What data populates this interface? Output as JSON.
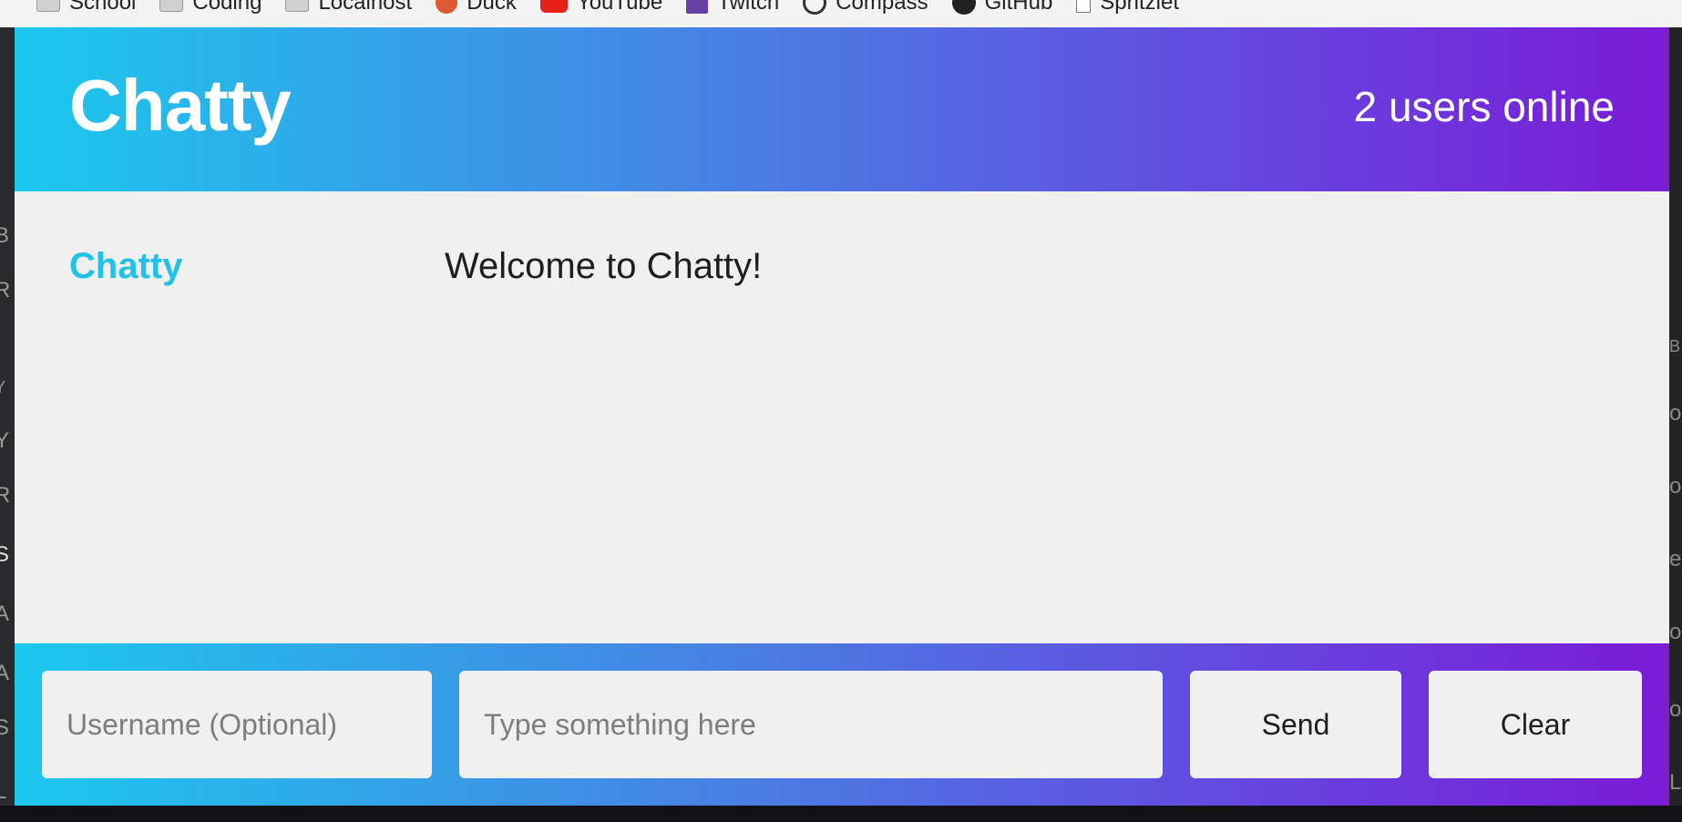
{
  "bookmarks": [
    {
      "label": "School",
      "icon": "folder-icon"
    },
    {
      "label": "Coding",
      "icon": "folder-icon"
    },
    {
      "label": "Localhost",
      "icon": "folder-icon"
    },
    {
      "label": "Duck",
      "icon": "duckduckgo-icon"
    },
    {
      "label": "YouTube",
      "icon": "youtube-icon"
    },
    {
      "label": "Twitch",
      "icon": "twitch-icon"
    },
    {
      "label": "Compass",
      "icon": "compass-icon"
    },
    {
      "label": "GitHub",
      "icon": "github-icon"
    },
    {
      "label": "Spritzlet",
      "icon": "page-icon"
    }
  ],
  "navbar": {
    "brand": "Chatty",
    "user_count": "2 users online"
  },
  "messages": [
    {
      "username": "Chatty",
      "content": "Welcome to Chatty!"
    }
  ],
  "chatbar": {
    "username_placeholder": "Username (Optional)",
    "message_placeholder": "Type something here",
    "send_label": "Send",
    "clear_label": "Clear"
  },
  "colors": {
    "gradient_start": "#1cc8ee",
    "gradient_end": "#7b1bd6",
    "username_color": "#22c2e8",
    "panel_background": "#f0f0f0"
  },
  "background_fragments": {
    "left": [
      "B",
      "R",
      "Y",
      "Y",
      "R",
      "S",
      "A",
      "A",
      "S",
      "L"
    ],
    "right": [
      "B",
      "o",
      "o",
      "e",
      "o",
      "o",
      "L"
    ]
  }
}
